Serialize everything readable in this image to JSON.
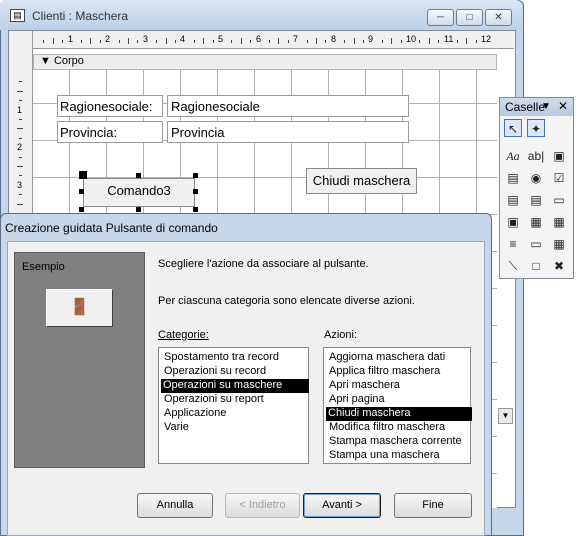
{
  "main_window": {
    "title": "Clienti : Maschera",
    "app_icon": "form-icon",
    "controls": {
      "minimize": "minimize-icon",
      "maximize": "maximize-icon",
      "close": "close-icon"
    }
  },
  "design": {
    "ruler_numbers": [
      "1",
      "2",
      "3",
      "4",
      "5",
      "6",
      "7",
      "8",
      "9",
      "10",
      "11",
      "12"
    ],
    "vertical_ruler_numbers": [
      "1",
      "2",
      "3"
    ],
    "section_label": "Corpo",
    "section_icon": "section-arrow-icon",
    "labels": {
      "ragione": "Ragionesociale:",
      "provincia": "Provincia:"
    },
    "fields": {
      "ragione": "Ragionesociale",
      "provincia": "Provincia"
    },
    "buttons": {
      "comando3": "Comando3",
      "chiudi": "Chiudi maschera"
    }
  },
  "toolbox": {
    "title": "Caselle",
    "tools": [
      "select-arrow-icon",
      "wizard-wand-icon",
      "label-tool-icon",
      "textbox-tool-icon",
      "option-group-icon",
      "toggle-button-icon",
      "option-button-icon",
      "checkbox-tool-icon",
      "combobox-tool-icon",
      "listbox-tool-icon",
      "command-button-icon",
      "image-tool-icon",
      "unbound-object-icon",
      "bound-object-icon",
      "page-break-icon",
      "tab-control-icon",
      "subform-icon",
      "line-tool-icon",
      "rectangle-tool-icon",
      "more-controls-icon"
    ]
  },
  "wizard": {
    "title": "Creazione guidata Pulsante di comando",
    "sample_label": "Esempio",
    "sample_icon": "exit-door-icon",
    "instruction_1": "Scegliere l'azione da associare al pulsante.",
    "instruction_2": "Per ciascuna categoria sono elencate diverse azioni.",
    "categories_label": "Categorie:",
    "actions_label": "Azioni:",
    "categories": [
      "Spostamento tra record",
      "Operazioni su record",
      "Operazioni su maschere",
      "Operazioni su report",
      "Applicazione",
      "Varie"
    ],
    "selected_category": "Operazioni su maschere",
    "actions": [
      "Aggiorna maschera dati",
      "Applica filtro maschera",
      "Apri maschera",
      "Apri pagina",
      "Chiudi maschera",
      "Modifica filtro maschera",
      "Stampa maschera corrente",
      "Stampa una maschera"
    ],
    "selected_action": "Chiudi maschera",
    "buttons": {
      "annulla": "Annulla",
      "indietro": "< Indietro",
      "avanti": "Avanti >",
      "fine": "Fine"
    }
  }
}
